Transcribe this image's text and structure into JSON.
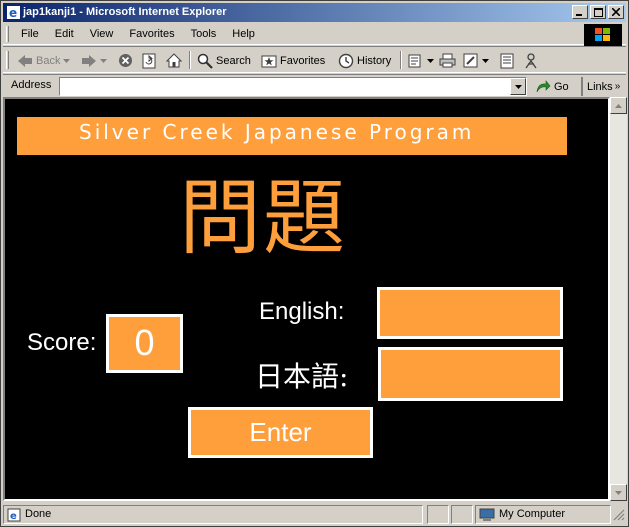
{
  "window": {
    "title": "jap1kanji1 - Microsoft Internet Explorer"
  },
  "menu": {
    "items": [
      "File",
      "Edit",
      "View",
      "Favorites",
      "Tools",
      "Help"
    ]
  },
  "toolbar": {
    "back": "Back",
    "search": "Search",
    "favorites": "Favorites",
    "history": "History"
  },
  "address": {
    "label": "Address",
    "value": "",
    "go": "Go",
    "links": "Links"
  },
  "page": {
    "banner": "Silver Creek Japanese Program",
    "title": "問題",
    "score_label": "Score:",
    "score_value": "0",
    "english_label": "English:",
    "japanese_label": "日本語:",
    "english_value": "",
    "japanese_value": "",
    "enter_label": "Enter"
  },
  "status": {
    "text": "Done",
    "zone": "My Computer"
  },
  "colors": {
    "accent": "#ff9f3c",
    "background": "#000000",
    "text": "#ffffff"
  }
}
